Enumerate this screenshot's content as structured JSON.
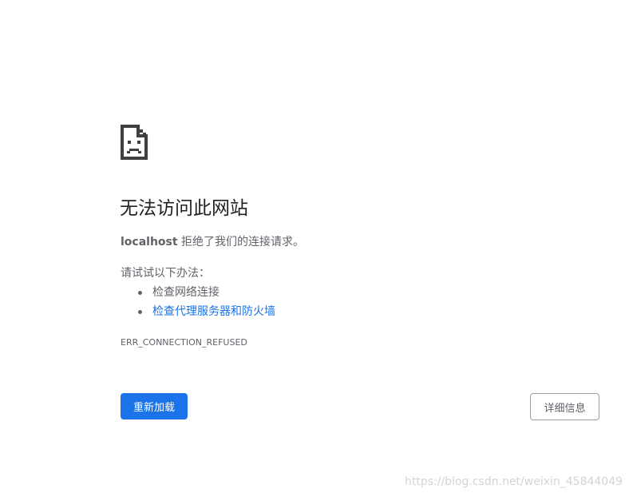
{
  "icon": "sad-document-icon",
  "title": "无法访问此网站",
  "message": {
    "host": "localhost",
    "text": " 拒绝了我们的连接请求。"
  },
  "suggestions": {
    "heading": "请试试以下办法：",
    "items": [
      {
        "label": "检查网络连接",
        "link": false
      },
      {
        "label": "检查代理服务器和防火墙",
        "link": true
      }
    ]
  },
  "error_code": "ERR_CONNECTION_REFUSED",
  "buttons": {
    "reload": "重新加载",
    "details": "详细信息"
  },
  "watermark": "https://blog.csdn.net/weixin_45844049",
  "colors": {
    "primary": "#1a73e8",
    "text": "#5f6368",
    "title": "#202124"
  }
}
